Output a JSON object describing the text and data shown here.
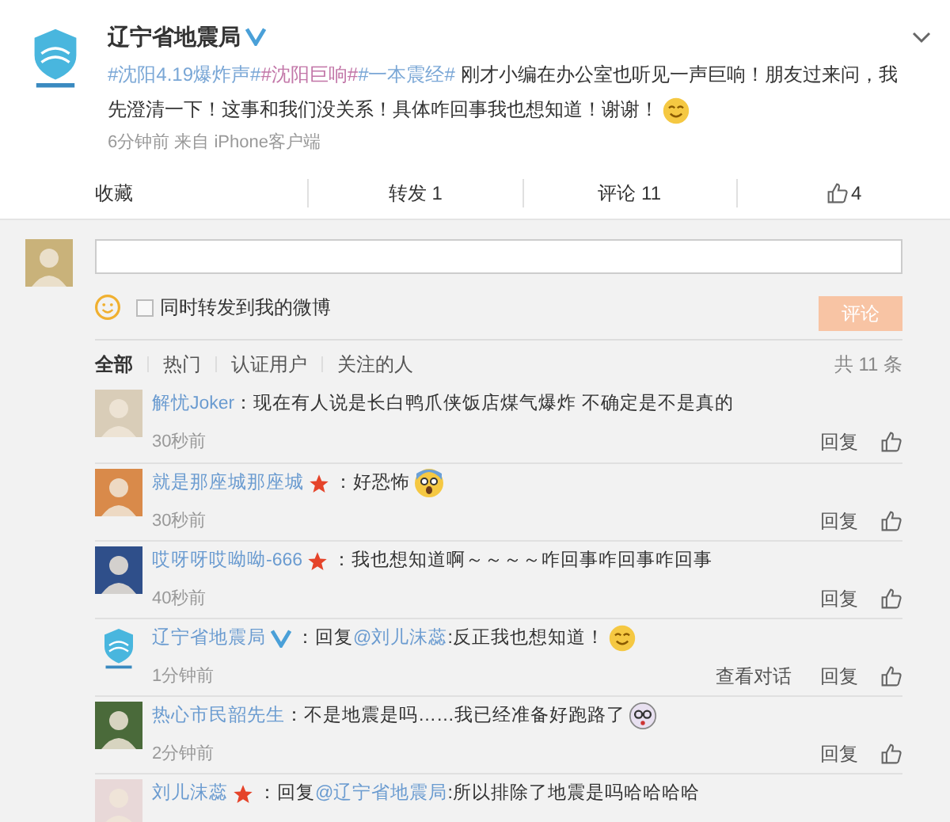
{
  "post": {
    "author": "辽宁省地震局",
    "verified": true,
    "parts": [
      {
        "text": "#沈阳4.19爆炸声#",
        "kind": "topic",
        "color": "#7aa7d6"
      },
      {
        "text": "#沈阳巨响#",
        "kind": "topic",
        "color": "#c276a8"
      },
      {
        "text": "#一本震经#",
        "kind": "topic",
        "color": "#7aa7d6"
      },
      {
        "text": " 刚才小编在办公室也听见一声巨响！朋友过来问，我先澄清一下！这事和我们没关系！具体咋回事我也想知道！谢谢！",
        "kind": "plain"
      },
      {
        "kind": "emoji-grin"
      }
    ],
    "meta": "6分钟前 来自 iPhone客户端"
  },
  "actions": [
    {
      "label": "收藏",
      "kind": "text"
    },
    {
      "label": "转发 1",
      "kind": "text"
    },
    {
      "label": "评论 11",
      "kind": "text"
    },
    {
      "label": "4",
      "kind": "like"
    }
  ],
  "compose": {
    "share_label": "同时转发到我的微博",
    "share_checked": false,
    "submit": "评论",
    "submit_disabled": true
  },
  "filters": [
    {
      "label": "全部",
      "selected": true
    },
    {
      "label": "热门",
      "selected": false
    },
    {
      "label": "认证用户",
      "selected": false
    },
    {
      "label": "关注的人",
      "selected": false
    }
  ],
  "total": "共 11 条",
  "comments": [
    {
      "name": "解忧Joker",
      "star": false,
      "verified": false,
      "parts": [
        {
          "text": "：现在有人说是长白鸭爪侠饭店煤气爆炸 不确定是不是真的",
          "kind": "plain"
        }
      ],
      "time": "30秒前",
      "actions": [
        "回复"
      ],
      "color": "#d9cdb8"
    },
    {
      "name": "就是那座城那座城",
      "star": true,
      "verified": false,
      "parts": [
        {
          "text": "：好恐怖",
          "kind": "plain"
        },
        {
          "kind": "emoji-fear"
        }
      ],
      "time": "30秒前",
      "actions": [
        "回复"
      ],
      "color": "#d98a4a"
    },
    {
      "name": "哎呀呀哎呦呦-666",
      "star": true,
      "verified": false,
      "parts": [
        {
          "text": "：我也想知道啊～～～～咋回事咋回事咋回事",
          "kind": "plain"
        }
      ],
      "time": "40秒前",
      "actions": [
        "回复"
      ],
      "color": "#2f4f8a"
    },
    {
      "name": "辽宁省地震局",
      "star": false,
      "verified": true,
      "parts": [
        {
          "text": "：回复",
          "kind": "plain"
        },
        {
          "text": "@刘儿沫蕊",
          "kind": "mention"
        },
        {
          "text": ":反正我也想知道！",
          "kind": "plain"
        },
        {
          "kind": "emoji-grin"
        }
      ],
      "time": "1分钟前",
      "actions": [
        "查看对话",
        "回复"
      ]
    },
    {
      "name": "热心市民韶先生",
      "star": false,
      "verified": false,
      "parts": [
        {
          "text": "：不是地震是吗……我已经准备好跑路了",
          "kind": "plain"
        },
        {
          "kind": "emoji-dizzy"
        }
      ],
      "time": "2分钟前",
      "actions": [
        "回复"
      ],
      "color": "#4a6a3a"
    },
    {
      "name": "刘儿沫蕊",
      "star": true,
      "verified": false,
      "parts": [
        {
          "text": "：回复",
          "kind": "plain"
        },
        {
          "text": "@辽宁省地震局",
          "kind": "mention"
        },
        {
          "text": ":所以排除了地震是吗哈哈哈哈",
          "kind": "plain"
        }
      ],
      "color": "#e8d8d8"
    }
  ]
}
